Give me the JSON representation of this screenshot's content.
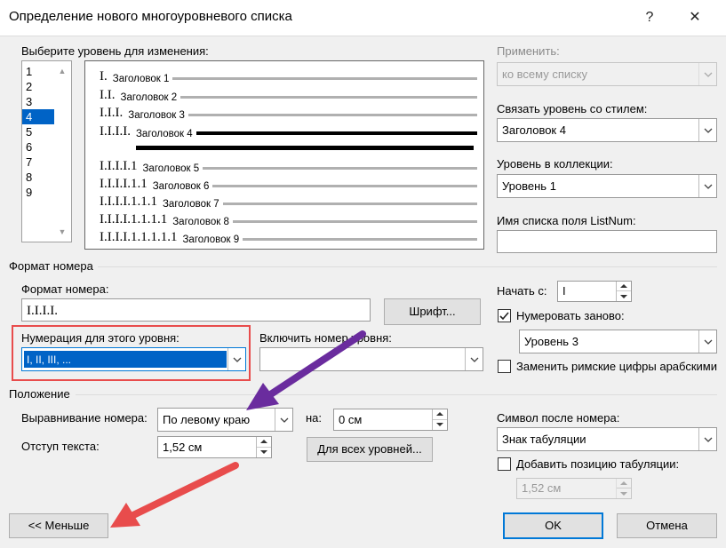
{
  "window": {
    "title": "Определение нового многоуровневого списка",
    "help_label": "?",
    "close_label": "✕"
  },
  "levels": {
    "label": "Выберите уровень для изменения:",
    "items": [
      "1",
      "2",
      "3",
      "4",
      "5",
      "6",
      "7",
      "8",
      "9"
    ],
    "selected_index": 3
  },
  "preview": {
    "rows": [
      {
        "number": "I.",
        "text": "Заголовок 1"
      },
      {
        "number": "I.I.",
        "text": "Заголовок 2"
      },
      {
        "number": "I.I.I.",
        "text": "Заголовок 3"
      },
      {
        "number": "I.I.I.I.",
        "text": "Заголовок 4"
      },
      {
        "number": "I.I.I.I.1",
        "text": "Заголовок 5"
      },
      {
        "number": "I.I.I.I.1.1",
        "text": "Заголовок 6"
      },
      {
        "number": "I.I.I.I.1.1.1",
        "text": "Заголовок 7"
      },
      {
        "number": "I.I.I.I.1.1.1.1",
        "text": "Заголовок 8"
      },
      {
        "number": "I.I.I.I.1.1.1.1.1",
        "text": "Заголовок 9"
      }
    ]
  },
  "apply": {
    "label": "Применить:",
    "value": "ко всему списку"
  },
  "link_style": {
    "label": "Связать уровень со стилем:",
    "value": "Заголовок 4"
  },
  "gallery_level": {
    "label": "Уровень в коллекции:",
    "value": "Уровень 1"
  },
  "listnum": {
    "label": "Имя списка поля ListNum:",
    "value": ""
  },
  "number_format": {
    "group_title": "Формат номера",
    "format_label": "Формат номера:",
    "format_value": "I.I.I.I.",
    "font_button": "Шрифт...",
    "style_label": "Нумерация для этого уровня:",
    "style_value": "I, II, III, ...",
    "include_label": "Включить номер уровня:",
    "include_value": "",
    "start_label": "Начать с:",
    "start_value": "I",
    "restart_label": "Нумеровать заново:",
    "restart_checked": true,
    "restart_value": "Уровень 3",
    "legal_label": "Заменить римские цифры арабскими",
    "legal_checked": false
  },
  "position": {
    "group_title": "Положение",
    "align_label": "Выравнивание номера:",
    "align_value": "По левому краю",
    "at_label": "на:",
    "at_value": "0 см",
    "indent_label": "Отступ текста:",
    "indent_value": "1,52 см",
    "all_levels_button": "Для всех уровней...",
    "follow_label": "Символ после номера:",
    "follow_value": "Знак табуляции",
    "add_tab_label": "Добавить позицию табуляции:",
    "add_tab_checked": false,
    "tab_value": "1,52 см"
  },
  "footer": {
    "less_button": "<< Меньше",
    "ok_button": "OK",
    "cancel_button": "Отмена"
  },
  "colors": {
    "selection": "#0063c6",
    "annotation_red": "#e84c4c",
    "annotation_purple": "#6a2c9e",
    "primary_border": "#0078d7"
  }
}
